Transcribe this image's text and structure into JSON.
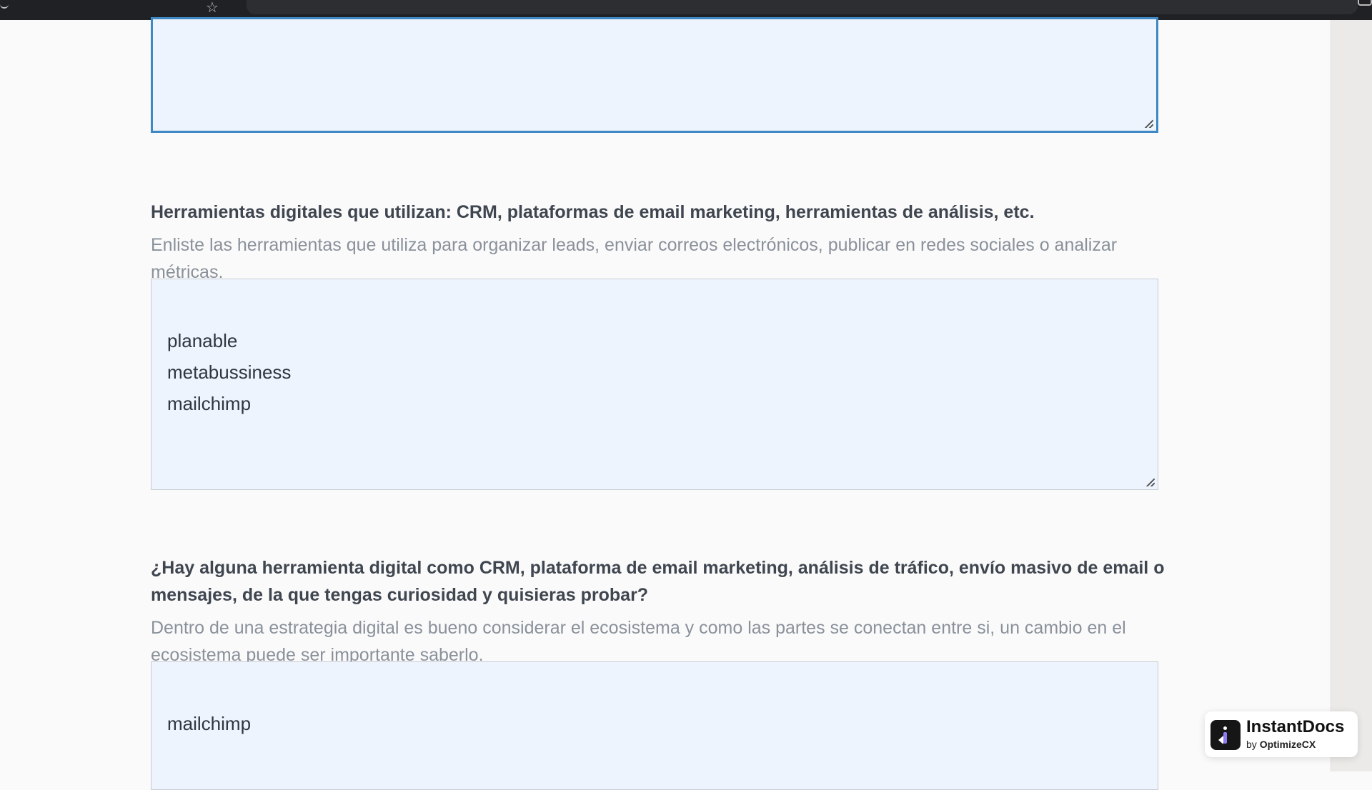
{
  "browser": {
    "bookmark_icon": "bookmark-star-icon"
  },
  "form": {
    "previous_field": {
      "value": ""
    },
    "q_tools": {
      "label": "Herramientas digitales que utilizan: CRM, plataformas de email marketing, herramientas de análisis, etc.",
      "help": "Enliste las herramientas que utiliza para organizar leads, enviar correos electrónicos, publicar en redes sociales o analizar métricas.",
      "value": "planable\nmetabussiness\nmailchimp"
    },
    "q_curious": {
      "label": "¿Hay alguna herramienta digital como CRM, plataforma de email marketing, análisis de tráfico, envío masivo de email o mensajes, de la que tengas curiosidad y quisieras probar?",
      "help": "Dentro de una estrategia digital es bueno considerar el ecosistema y como las partes se conectan entre si, un cambio en el ecosistema puede ser importante saberlo.",
      "value": "mailchimp"
    }
  },
  "badge": {
    "brand": "InstantDocs",
    "by_prefix": "by ",
    "by_name": "OptimizeCX",
    "logo_icon": "instantdocs-logo-icon"
  },
  "colors": {
    "textarea_bg": "#edf4fd",
    "focus_border": "#3e88c4",
    "label_text": "#3f4650",
    "help_text": "#8a919b"
  }
}
